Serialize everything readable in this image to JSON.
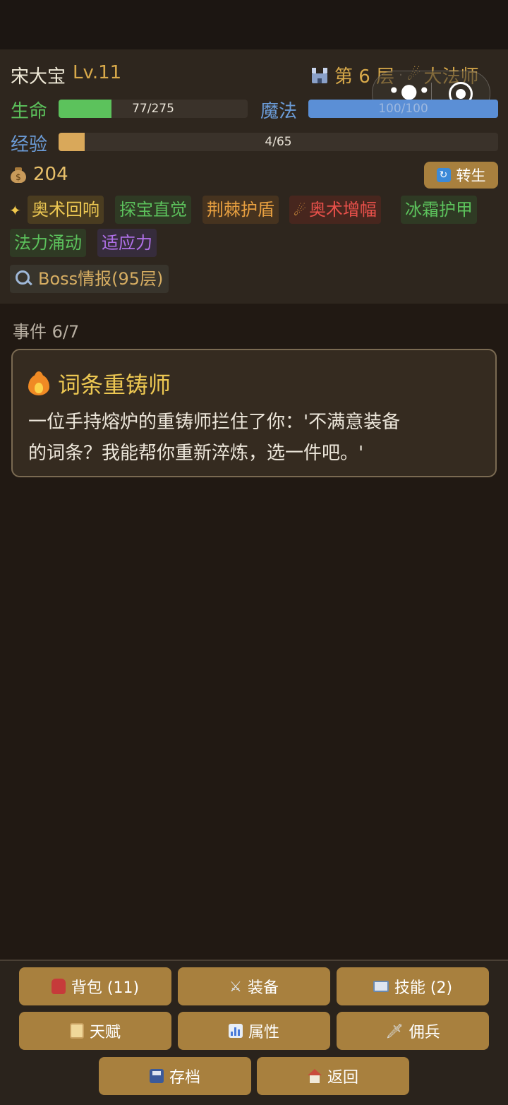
{
  "player": {
    "name": "宋大宝",
    "level": "Lv.11"
  },
  "floor": {
    "label": "第 6 层",
    "separator": "·",
    "class_name": "大法师",
    "class_icon": "comet-icon"
  },
  "stats": {
    "hp_label": "生命",
    "hp_text": "77/275",
    "hp_fraction": 0.28,
    "hp_color": "#5cc25c",
    "mp_label": "魔法",
    "mp_text": "100/100",
    "mp_fraction": 1.0,
    "mp_color": "#5b8fd6",
    "xp_label": "经验",
    "xp_text": "4/65",
    "xp_fraction": 0.06,
    "xp_color": "#d9a85a"
  },
  "gold": {
    "amount": "204",
    "icon": "money-bag-icon"
  },
  "rebirth_button": {
    "label": "转生"
  },
  "skill_tags": [
    {
      "label": "奥术回响",
      "color": "gold"
    },
    {
      "label": "探宝直觉",
      "color": "green"
    },
    {
      "label": "荆棘护盾",
      "color": "orange"
    },
    {
      "label": "奥术增幅",
      "color": "red"
    },
    {
      "label": "冰霜护甲",
      "color": "green"
    },
    {
      "label": "法力涌动",
      "color": "green"
    },
    {
      "label": "适应力",
      "color": "purple"
    }
  ],
  "boss_info": {
    "label": "Boss情报(95层)"
  },
  "event": {
    "counter": "事件 6/7",
    "title": "词条重铸师",
    "description_line1": "一位手持熔炉的重铸师拦住了你：'不满意装备",
    "description_line2": "的词条？我能帮你重新淬炼，选一件吧。'"
  },
  "bottom_nav": {
    "backpack": "背包 (11)",
    "equipment": "装备",
    "skills": "技能 (2)",
    "talents": "天赋",
    "attributes": "属性",
    "mercenaries": "佣兵",
    "save": "存档",
    "back": "返回"
  },
  "mini_program": {
    "more_icon": "more-dots-icon",
    "close_icon": "target-close-icon"
  }
}
